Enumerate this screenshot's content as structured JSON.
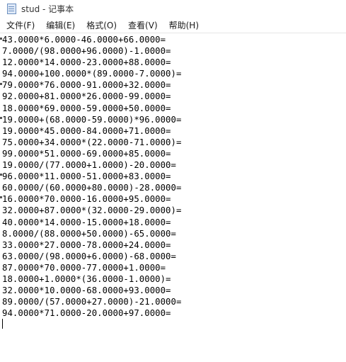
{
  "window": {
    "title": "stud - 记事本"
  },
  "menubar": {
    "items": [
      {
        "label": "文件(F)"
      },
      {
        "label": "编辑(E)"
      },
      {
        "label": "格式(O)"
      },
      {
        "label": "查看(V)"
      },
      {
        "label": "帮助(H)"
      }
    ]
  },
  "editor": {
    "lines": [
      "43.0000*6.0000-46.0000+66.0000=",
      "7.0000/(98.0000+96.0000)-1.0000=",
      "12.0000*14.0000-23.0000+88.0000=",
      "94.0000+100.0000*(89.0000-7.0000)=",
      "79.0000*76.0000-91.0000+32.0000=",
      "92.0000+81.0000*26.0000-99.0000=",
      "18.0000*69.0000-59.0000+50.0000=",
      "19.0000+(68.0000-59.0000)*96.0000=",
      "19.0000*45.0000-84.0000+71.0000=",
      "75.0000+34.0000*(22.0000-71.0000)=",
      "99.0000*51.0000-69.0000+85.0000=",
      "19.0000/(77.0000+1.0000)-20.0000=",
      "96.0000*11.0000-51.0000+83.0000=",
      "60.0000/(60.0000+80.0000)-28.0000=",
      "16.0000*70.0000-16.0000+95.0000=",
      "32.0000+87.0000*(32.0000-29.0000)=",
      "40.0000*14.0000-15.0000+18.0000=",
      "8.0000/(88.0000+50.0000)-65.0000=",
      "33.0000*27.0000-78.0000+24.0000=",
      "63.0000/(98.0000+6.0000)-68.0000=",
      "87.0000*70.0000-77.0000+1.0000=",
      "18.0000+1.0000*(36.0000-1.0000)=",
      "32.0000*10.0000-68.0000+93.0000=",
      "89.0000/(57.0000+27.0000)-21.0000=",
      "94.0000*71.0000-20.0000+97.0000="
    ]
  }
}
